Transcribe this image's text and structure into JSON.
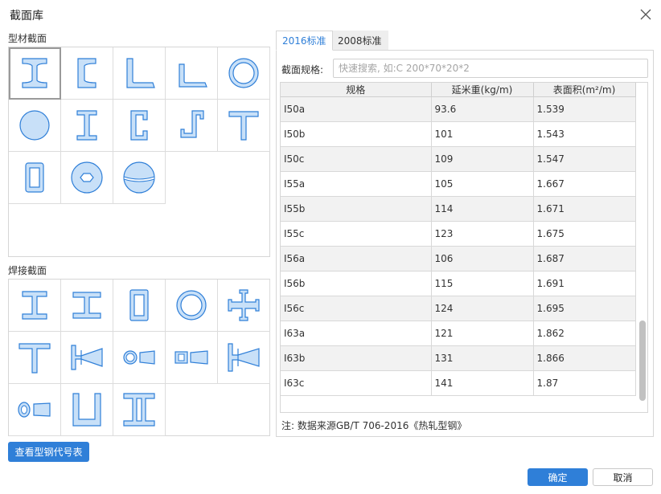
{
  "dialog": {
    "title": "截面库"
  },
  "profiles": {
    "label": "型材截面",
    "items": [
      {
        "icon": "i-beam-icon"
      },
      {
        "icon": "channel-icon"
      },
      {
        "icon": "equal-angle-icon"
      },
      {
        "icon": "unequal-angle-icon"
      },
      {
        "icon": "round-tube-icon"
      },
      {
        "icon": "solid-circle-icon"
      },
      {
        "icon": "h-beam-icon"
      },
      {
        "icon": "c-channel-icon"
      },
      {
        "icon": "z-section-icon"
      },
      {
        "icon": "t-section-icon"
      },
      {
        "icon": "rect-tube-icon"
      },
      {
        "icon": "hex-hole-disc-icon"
      },
      {
        "icon": "split-sphere-icon"
      }
    ]
  },
  "welded": {
    "label": "焊接截面",
    "items": [
      {
        "icon": "welded-i-icon"
      },
      {
        "icon": "welded-h-icon"
      },
      {
        "icon": "welded-box-icon"
      },
      {
        "icon": "welded-ring-icon"
      },
      {
        "icon": "welded-cross-icon"
      },
      {
        "icon": "welded-t-icon"
      },
      {
        "icon": "tapered-i-icon"
      },
      {
        "icon": "tapered-round-icon"
      },
      {
        "icon": "tapered-box-icon"
      },
      {
        "icon": "tapered-h-icon"
      },
      {
        "icon": "tapered-ellipse-icon"
      },
      {
        "icon": "u-section-icon"
      },
      {
        "icon": "double-channel-icon"
      }
    ]
  },
  "tabs": [
    {
      "label": "2016标准",
      "active": true
    },
    {
      "label": "2008标准",
      "active": false
    }
  ],
  "search": {
    "label": "截面规格:",
    "placeholder": "快速搜索, 如:C 200*70*20*2",
    "value": ""
  },
  "table": {
    "headers": [
      "规格",
      "延米重(kg/m)",
      "表面积(m²/m)"
    ],
    "rows": [
      [
        "I50a",
        "93.6",
        "1.539"
      ],
      [
        "I50b",
        "101",
        "1.543"
      ],
      [
        "I50c",
        "109",
        "1.547"
      ],
      [
        "I55a",
        "105",
        "1.667"
      ],
      [
        "I55b",
        "114",
        "1.671"
      ],
      [
        "I55c",
        "123",
        "1.675"
      ],
      [
        "I56a",
        "106",
        "1.687"
      ],
      [
        "I56b",
        "115",
        "1.691"
      ],
      [
        "I56c",
        "124",
        "1.695"
      ],
      [
        "I63a",
        "121",
        "1.862"
      ],
      [
        "I63b",
        "131",
        "1.866"
      ],
      [
        "I63c",
        "141",
        "1.87"
      ]
    ]
  },
  "footnote": "注: 数据来源GB/T 706-2016《热轧型钢》",
  "buttons": {
    "view_codes": "查看型钢代号表",
    "ok": "确定",
    "cancel": "取消"
  },
  "colors": {
    "accent": "#2f7fd8",
    "icon_fill": "#c8e0f8",
    "icon_stroke": "#2f7fd8"
  }
}
